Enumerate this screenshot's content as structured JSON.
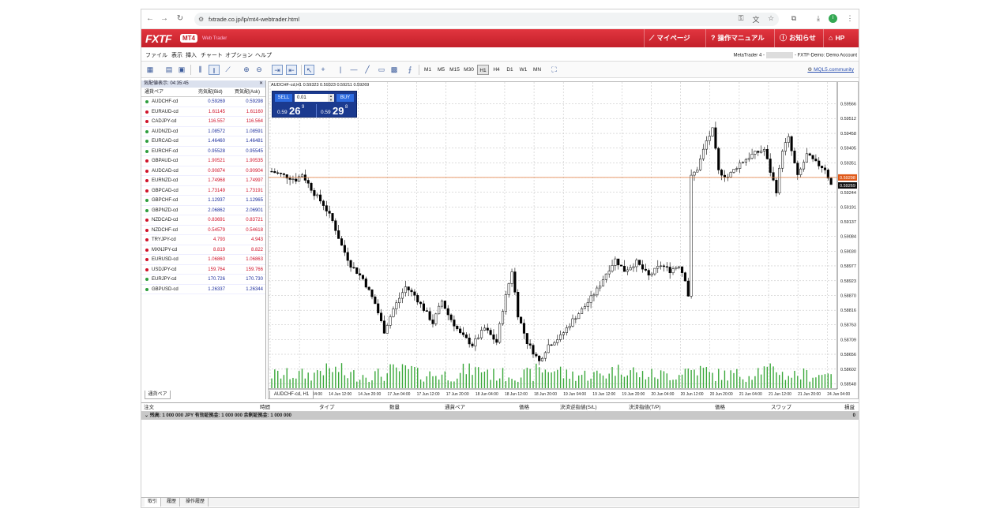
{
  "browser": {
    "url": "fxtrade.co.jp/lp/mt4-webtrader.html",
    "avatar_letter": "I"
  },
  "header": {
    "logo": "FXTF",
    "badge": "MT4",
    "subtitle": "Web Trader",
    "nav": [
      {
        "label": "マイページ",
        "icon": "chart-icon"
      },
      {
        "label": "操作マニュアル",
        "icon": "question-icon"
      },
      {
        "label": "お知らせ",
        "icon": "info-icon"
      },
      {
        "label": "HP",
        "icon": "home-icon"
      }
    ]
  },
  "menu": {
    "items": [
      "ファイル",
      "表示",
      "挿入",
      "チャート",
      "オプション",
      "ヘルプ"
    ],
    "account_prefix": "MetaTrader 4 -",
    "account_suffix": "- FXTF-Demo: Demo Account"
  },
  "toolbar": {
    "timeframes": [
      "M1",
      "M5",
      "M15",
      "M30",
      "H1",
      "H4",
      "D1",
      "W1",
      "MN"
    ],
    "active_timeframe": "H1",
    "mql_link": "MQL5.community"
  },
  "market_watch": {
    "title": "気配値表示: 04:35:45",
    "col_symbol": "通貨ペア",
    "col_bid": "売気配(Bid)",
    "col_ask": "買気配(Ask)",
    "tab": "通貨ペア",
    "rows": [
      {
        "symbol": "AUDCHF-cd",
        "bid": "0.59269",
        "ask": "0.59298",
        "dir": "up"
      },
      {
        "symbol": "EURAUD-cd",
        "bid": "1.61145",
        "ask": "1.61160",
        "dir": "dn"
      },
      {
        "symbol": "CADJPY-cd",
        "bid": "116.557",
        "ask": "116.564",
        "dir": "dn"
      },
      {
        "symbol": "AUDNZD-cd",
        "bid": "1.08572",
        "ask": "1.08591",
        "dir": "up"
      },
      {
        "symbol": "EURCAD-cd",
        "bid": "1.46460",
        "ask": "1.46481",
        "dir": "up"
      },
      {
        "symbol": "EURCHF-cd",
        "bid": "0.95528",
        "ask": "0.95545",
        "dir": "up"
      },
      {
        "symbol": "GBPAUD-cd",
        "bid": "1.90521",
        "ask": "1.90535",
        "dir": "dn"
      },
      {
        "symbol": "AUDCAD-cd",
        "bid": "0.90874",
        "ask": "0.90904",
        "dir": "dn"
      },
      {
        "symbol": "EURNZD-cd",
        "bid": "1.74968",
        "ask": "1.74997",
        "dir": "dn"
      },
      {
        "symbol": "GBPCAD-cd",
        "bid": "1.73149",
        "ask": "1.73191",
        "dir": "dn"
      },
      {
        "symbol": "GBPCHF-cd",
        "bid": "1.12937",
        "ask": "1.12965",
        "dir": "up"
      },
      {
        "symbol": "GBPNZD-cd",
        "bid": "2.06862",
        "ask": "2.06901",
        "dir": "up"
      },
      {
        "symbol": "NZDCAD-cd",
        "bid": "0.83691",
        "ask": "0.83721",
        "dir": "dn"
      },
      {
        "symbol": "NZDCHF-cd",
        "bid": "0.54579",
        "ask": "0.54618",
        "dir": "dn"
      },
      {
        "symbol": "TRYJPY-cd",
        "bid": "4.793",
        "ask": "4.943",
        "dir": "dn"
      },
      {
        "symbol": "MXNJPY-cd",
        "bid": "8.819",
        "ask": "8.822",
        "dir": "dn"
      },
      {
        "symbol": "EURUSD-cd",
        "bid": "1.06860",
        "ask": "1.06863",
        "dir": "dn"
      },
      {
        "symbol": "USDJPY-cd",
        "bid": "159.764",
        "ask": "159.766",
        "dir": "dn"
      },
      {
        "symbol": "EURJPY-cd",
        "bid": "170.726",
        "ask": "170.730",
        "dir": "up"
      },
      {
        "symbol": "GBPUSD-cd",
        "bid": "1.26337",
        "ask": "1.26344",
        "dir": "up"
      }
    ]
  },
  "chart": {
    "title": "AUDCHF-cd,H1  0.59323 0.59323 0.59211 0.59269",
    "tab": "AUDCHF-cd, H1",
    "colors": {
      "bid_line": "#e07a3a",
      "bid_label": "#e05a1a",
      "cur_label": "#111111",
      "candle": "#000000",
      "volume": "#3aa83a",
      "grid": "#bbbbbb"
    }
  },
  "one_click": {
    "sell": "SELL",
    "buy": "BUY",
    "lot": "0.01",
    "sell_price": {
      "prefix": "0.59",
      "big": "26",
      "sup": "9"
    },
    "buy_price": {
      "prefix": "0.59",
      "big": "29",
      "sup": "8"
    }
  },
  "chart_data": {
    "type": "candlestick",
    "symbol": "AUDCHF-cd",
    "timeframe": "H1",
    "y_ticks": [
      0.59566,
      0.59512,
      0.59458,
      0.59405,
      0.59351,
      0.59298,
      0.59244,
      0.59191,
      0.59137,
      0.59084,
      0.5903,
      0.58977,
      0.58923,
      0.5887,
      0.58816,
      0.58763,
      0.58709,
      0.58656,
      0.58602,
      0.58548
    ],
    "x_ticks": [
      "13 Jun 2024",
      "14 Jun 04:00",
      "14 Jun 12:00",
      "14 Jun 20:00",
      "17 Jun 04:00",
      "17 Jun 12:00",
      "17 Jun 20:00",
      "18 Jun 04:00",
      "18 Jun 12:00",
      "18 Jun 20:00",
      "19 Jun 04:00",
      "19 Jun 12:00",
      "19 Jun 20:00",
      "20 Jun 04:00",
      "20 Jun 12:00",
      "20 Jun 20:00",
      "21 Jun 04:00",
      "21 Jun 12:00",
      "21 Jun 20:00",
      "24 Jun 04:00"
    ],
    "bid_price": "0.59298",
    "current_price": "0.59269",
    "ylim": [
      0.5853,
      0.5961
    ],
    "close_path": [
      [
        0,
        0.5932
      ],
      [
        8,
        0.5929
      ],
      [
        10,
        0.5931
      ],
      [
        14,
        0.5924
      ],
      [
        17,
        0.592
      ],
      [
        20,
        0.5914
      ],
      [
        23,
        0.5905
      ],
      [
        26,
        0.5898
      ],
      [
        30,
        0.5893
      ],
      [
        34,
        0.5884
      ],
      [
        37,
        0.5874
      ],
      [
        40,
        0.5882
      ],
      [
        44,
        0.589
      ],
      [
        47,
        0.5887
      ],
      [
        50,
        0.5882
      ],
      [
        53,
        0.5877
      ],
      [
        56,
        0.5885
      ],
      [
        58,
        0.588
      ],
      [
        62,
        0.5873
      ],
      [
        66,
        0.5869
      ],
      [
        70,
        0.5875
      ],
      [
        74,
        0.587
      ],
      [
        76,
        0.5882
      ],
      [
        79,
        0.5896
      ],
      [
        81,
        0.588
      ],
      [
        84,
        0.587
      ],
      [
        88,
        0.5863
      ],
      [
        91,
        0.5869
      ],
      [
        95,
        0.5872
      ],
      [
        99,
        0.5878
      ],
      [
        103,
        0.5883
      ],
      [
        107,
        0.5889
      ],
      [
        110,
        0.5895
      ],
      [
        113,
        0.59
      ],
      [
        116,
        0.5896
      ],
      [
        120,
        0.5899
      ],
      [
        124,
        0.5894
      ],
      [
        128,
        0.5898
      ],
      [
        131,
        0.5896
      ],
      [
        134,
        0.5898
      ],
      [
        136,
        0.5893
      ],
      [
        137,
        0.5887
      ],
      [
        138,
        0.593
      ],
      [
        140,
        0.5933
      ],
      [
        143,
        0.5943
      ],
      [
        145,
        0.5947
      ],
      [
        147,
        0.5932
      ],
      [
        150,
        0.593
      ],
      [
        154,
        0.5935
      ],
      [
        158,
        0.5938
      ],
      [
        162,
        0.594
      ],
      [
        164,
        0.5932
      ],
      [
        166,
        0.5925
      ],
      [
        168,
        0.594
      ],
      [
        170,
        0.5944
      ],
      [
        173,
        0.593
      ],
      [
        176,
        0.5938
      ],
      [
        179,
        0.5935
      ],
      [
        182,
        0.5933
      ],
      [
        184,
        0.5927
      ]
    ]
  },
  "terminal": {
    "columns": [
      "注文",
      "時間",
      "タイプ",
      "数量",
      "通貨ペア",
      "価格",
      "決済逆指値(S/L)",
      "決済指値(T/P)",
      "価格",
      "スワップ",
      "損益"
    ],
    "balance": "残高: 1 000 000 JPY  有効証拠金: 1 000 000  余剰証拠金: 1 000 000",
    "balance_value": "0",
    "tabs": [
      "取引",
      "履歴",
      "操作履歴"
    ],
    "active_tab": "取引"
  }
}
